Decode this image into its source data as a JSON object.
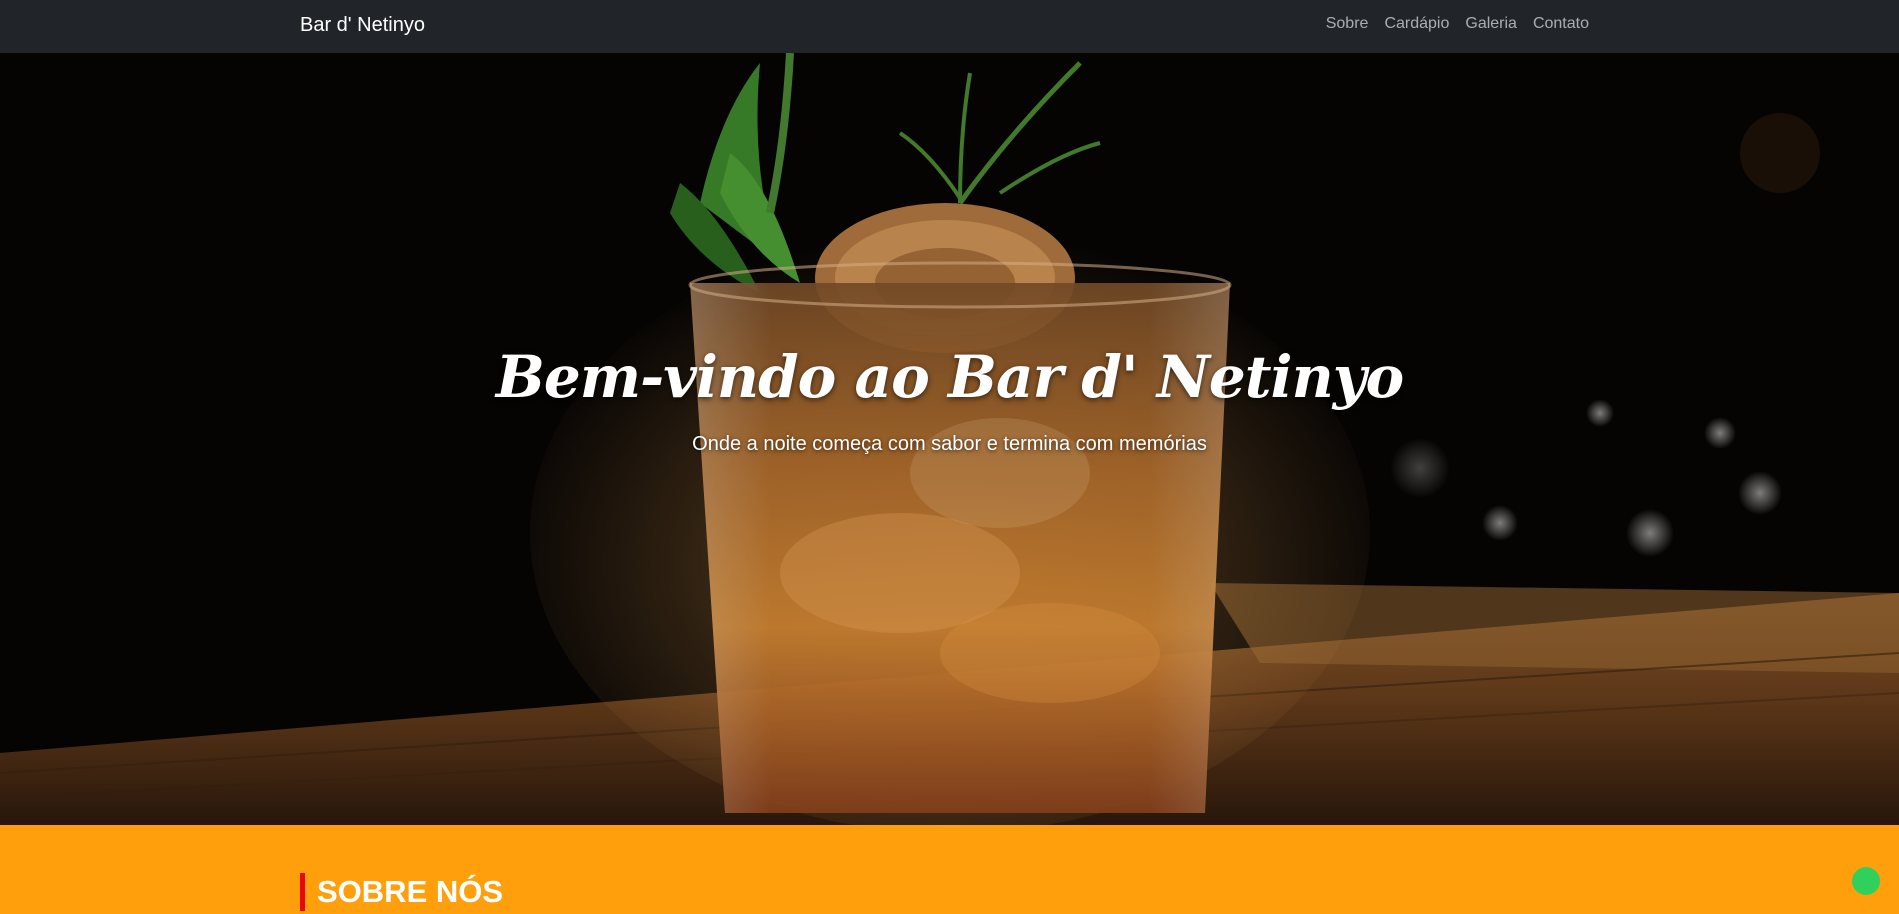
{
  "navbar": {
    "brand": "Bar d' Netinyo",
    "links": [
      "Sobre",
      "Cardápio",
      "Galeria",
      "Contato"
    ]
  },
  "hero": {
    "title": "Bem-vindo ao Bar d' Netinyo",
    "subtitle": "Onde a noite começa com sabor e termina com memórias"
  },
  "about": {
    "heading": "SOBRE NÓS"
  },
  "colors": {
    "navbar_bg": "#212529",
    "section_orange": "#ff9f0c",
    "accent_red": "#e8070d",
    "status_green": "#2fd15c"
  }
}
